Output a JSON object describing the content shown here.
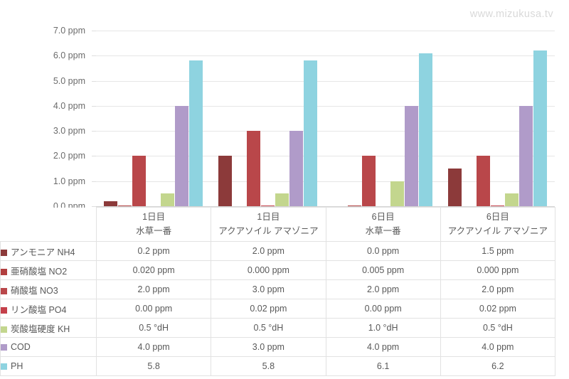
{
  "watermark": "www.mizukusa.tv",
  "chart_data": {
    "type": "bar",
    "title": "",
    "xlabel": "",
    "ylabel": "",
    "ylim": [
      0,
      7
    ],
    "grid": true,
    "legend_position": "table-left",
    "categories": [
      {
        "line1": "1日目",
        "line2": "水草一番"
      },
      {
        "line1": "1日目",
        "line2": "アクアソイル アマゾニア"
      },
      {
        "line1": "6日目",
        "line2": "水草一番"
      },
      {
        "line1": "6日目",
        "line2": "アクアソイル アマゾニア"
      }
    ],
    "y_ticks": [
      "0.0 ppm",
      "1.0 ppm",
      "2.0 ppm",
      "3.0 ppm",
      "4.0 ppm",
      "5.0 ppm",
      "6.0 ppm",
      "7.0 ppm"
    ],
    "series": [
      {
        "name": "アンモニア NH4",
        "color": "#8c3a3a",
        "values": [
          0.2,
          2.0,
          0.0,
          1.5
        ],
        "labels": [
          "0.2 ppm",
          "2.0 ppm",
          "0.0 ppm",
          "1.5 ppm"
        ]
      },
      {
        "name": "亜硝酸塩  NO2",
        "color": "#b23f3f",
        "values": [
          0.02,
          0.0,
          0.005,
          0.0
        ],
        "labels": [
          "0.020 ppm",
          "0.000 ppm",
          "0.005 ppm",
          "0.000 ppm"
        ]
      },
      {
        "name": "硝酸塩 NO3",
        "color": "#b9474a",
        "values": [
          2.0,
          3.0,
          2.0,
          2.0
        ],
        "labels": [
          "2.0 ppm",
          "3.0 ppm",
          "2.0 ppm",
          "2.0 ppm"
        ]
      },
      {
        "name": "リン酸塩  PO4",
        "color": "#c4404a",
        "values": [
          0.0,
          0.02,
          0.0,
          0.02
        ],
        "labels": [
          "0.00 ppm",
          "0.02 ppm",
          "0.00 ppm",
          "0.02 ppm"
        ]
      },
      {
        "name": "炭酸塩硬度 KH",
        "color": "#c3d68e",
        "values": [
          0.5,
          0.5,
          1.0,
          0.5
        ],
        "labels": [
          "0.5 °dH",
          "0.5 °dH",
          "1.0 °dH",
          "0.5 °dH"
        ]
      },
      {
        "name": "COD",
        "color": "#b09bc9",
        "values": [
          4.0,
          3.0,
          4.0,
          4.0
        ],
        "labels": [
          "4.0 ppm",
          "3.0 ppm",
          "4.0 ppm",
          "4.0 ppm"
        ]
      },
      {
        "name": "PH",
        "color": "#8ed3e0",
        "values": [
          5.8,
          5.8,
          6.1,
          6.2
        ],
        "labels": [
          "5.8",
          "5.8",
          "6.1",
          "6.2"
        ]
      }
    ]
  }
}
